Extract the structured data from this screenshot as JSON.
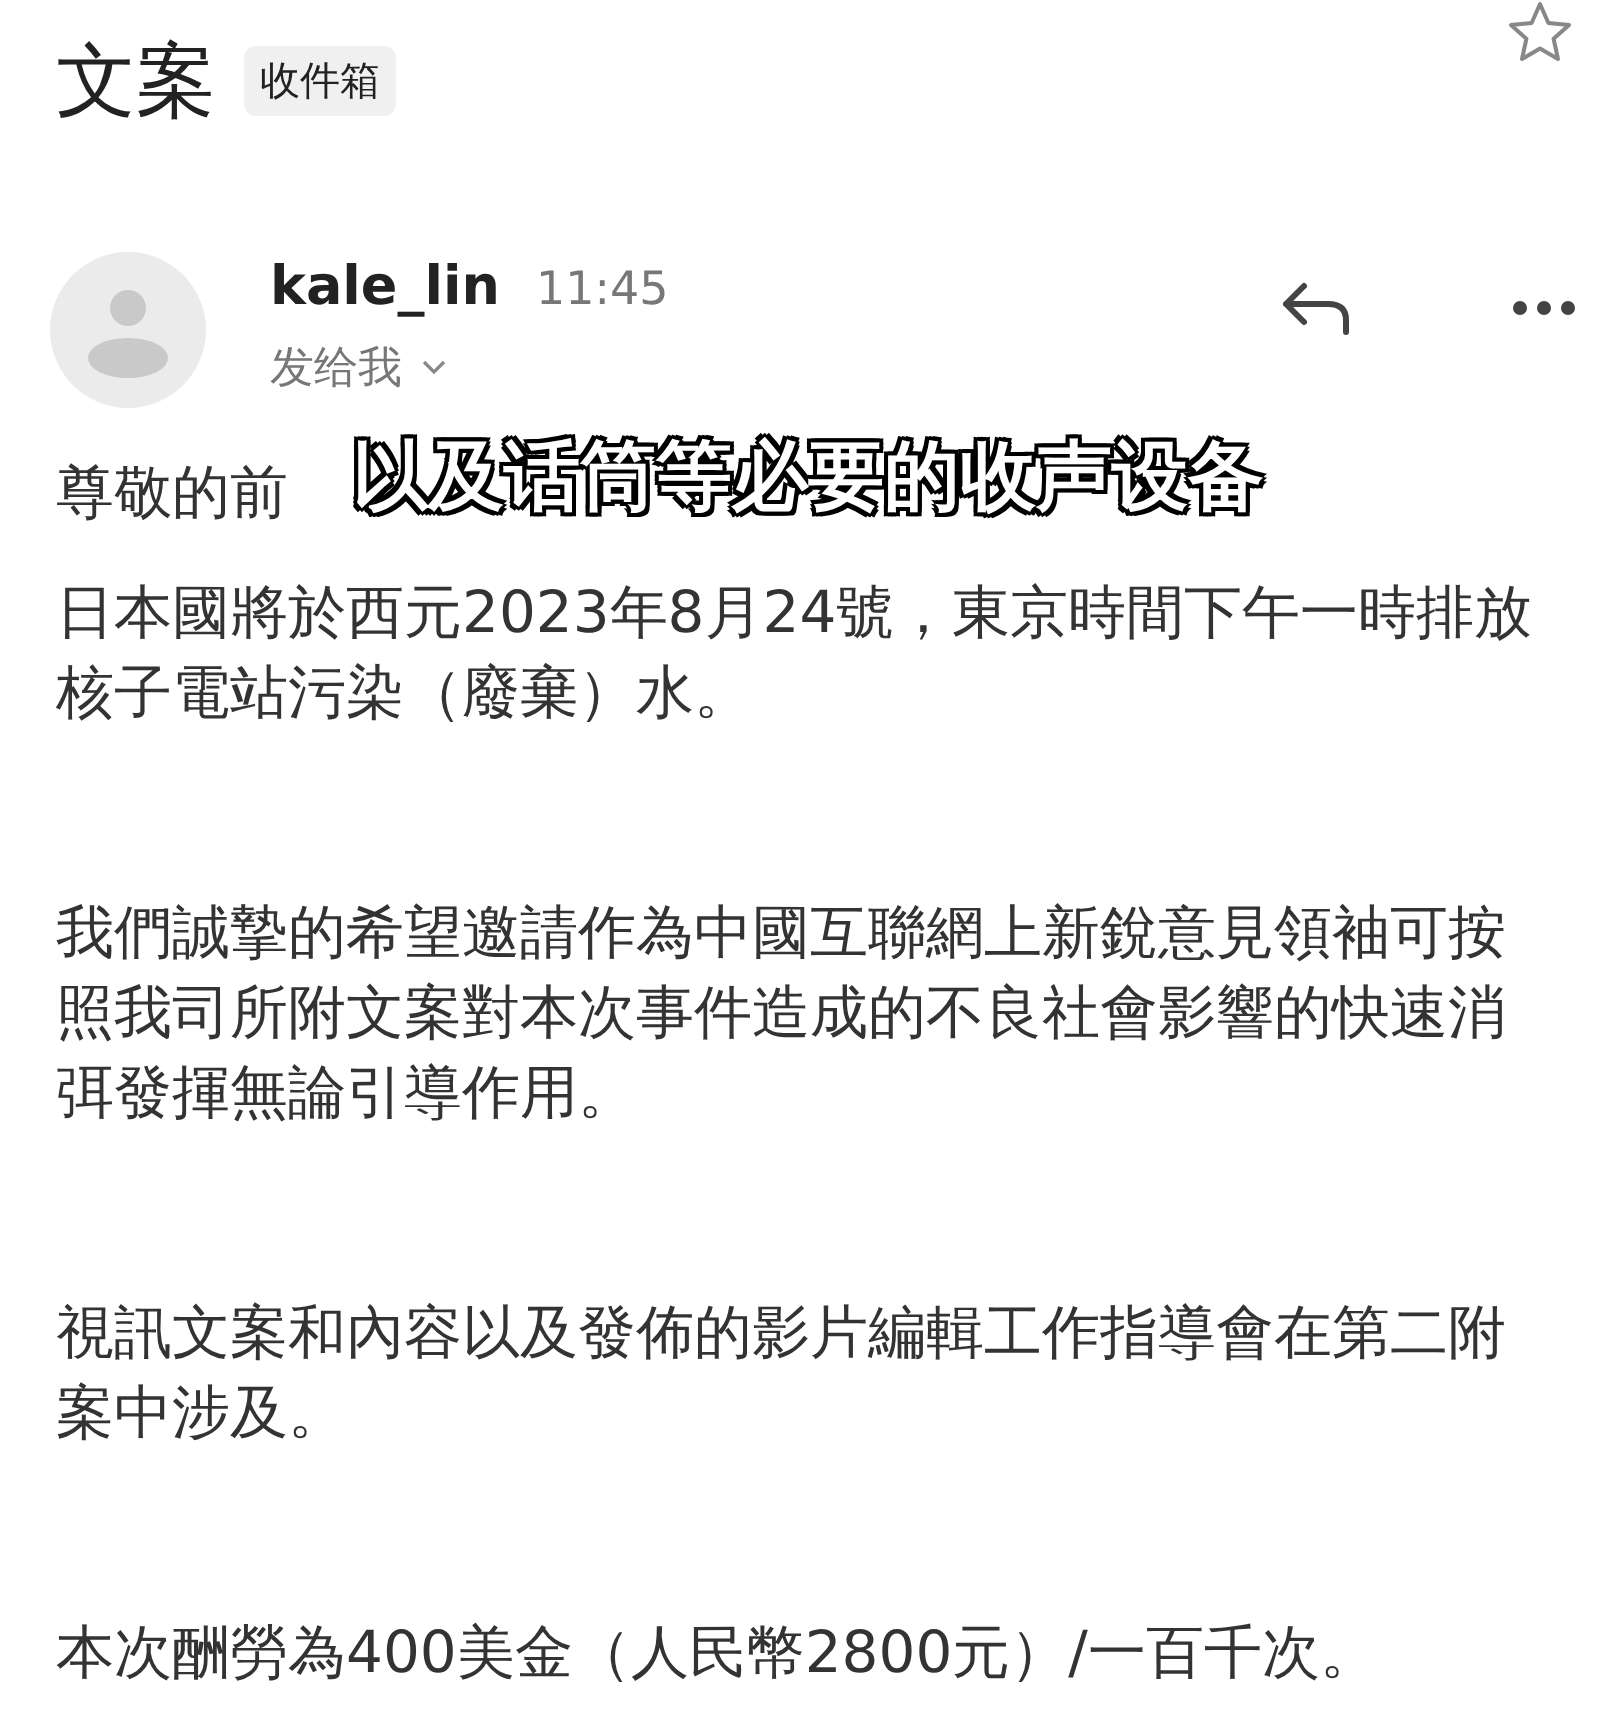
{
  "header": {
    "title": "文案",
    "label": "收件箱",
    "starred": false
  },
  "message": {
    "sender": "kale_lin",
    "time": "11:45",
    "recipient": "发给我"
  },
  "body": {
    "greeting": "尊敬的前",
    "paragraphs": [
      "日本國將於西元2023年8月24號，東京時間下午一時排放核子電站污染（廢棄）水。",
      "我們誠摯的希望邀請作為中國互聯網上新銳意見領袖可按照我司所附文案對本次事件造成的不良社會影響的快速消弭發揮無論引導作用。",
      "視訊文案和內容以及發佈的影片編輯工作指導會在第二附案中涉及。",
      "本次酬勞為400美金（人民幣2800元）/一百千次。"
    ]
  },
  "subtitle": "以及话筒等必要的收声设备"
}
